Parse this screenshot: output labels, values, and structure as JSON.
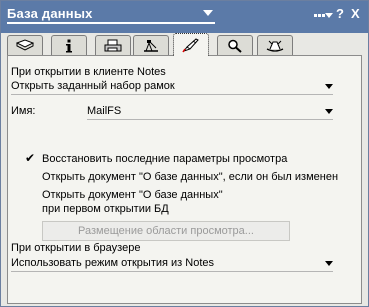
{
  "window": {
    "title": "База данных",
    "help_label": "?",
    "close_label": "X"
  },
  "tabs": [
    {
      "name": "info",
      "icon": "book-icon",
      "active": false
    },
    {
      "name": "details",
      "icon": "info-icon",
      "active": false
    },
    {
      "name": "print",
      "icon": "printer-icon",
      "active": false
    },
    {
      "name": "design",
      "icon": "design-icon",
      "active": false
    },
    {
      "name": "launch",
      "icon": "rocket-icon",
      "active": true
    },
    {
      "name": "search",
      "icon": "magnifier-icon",
      "active": false
    },
    {
      "name": "advanced",
      "icon": "hat-icon",
      "active": false
    }
  ],
  "notes_open": {
    "label": "При открытии в клиенте Notes",
    "value": "Открыть заданный набор рамок"
  },
  "name_field": {
    "label": "Имя:",
    "value": "MailFS"
  },
  "options": [
    {
      "label": "Восстановить последние параметры просмотра",
      "checked": true,
      "mark": "✔"
    },
    {
      "label": "Открыть документ \"О базе данных\", если он был изменен",
      "checked": false,
      "mark": ""
    },
    {
      "label": "Открыть документ \"О базе данных\"",
      "sublabel": "при первом открытии БД",
      "checked": false,
      "mark": ""
    }
  ],
  "preview_button": {
    "label": "Размещение области просмотра..."
  },
  "browser_open": {
    "label": "При открытии в браузере",
    "value": "Использовать режим открытия из Notes"
  },
  "colors": {
    "titlebar": "#5b7aa8",
    "panel": "#f4f4f0",
    "frame": "#e8e8e4"
  }
}
